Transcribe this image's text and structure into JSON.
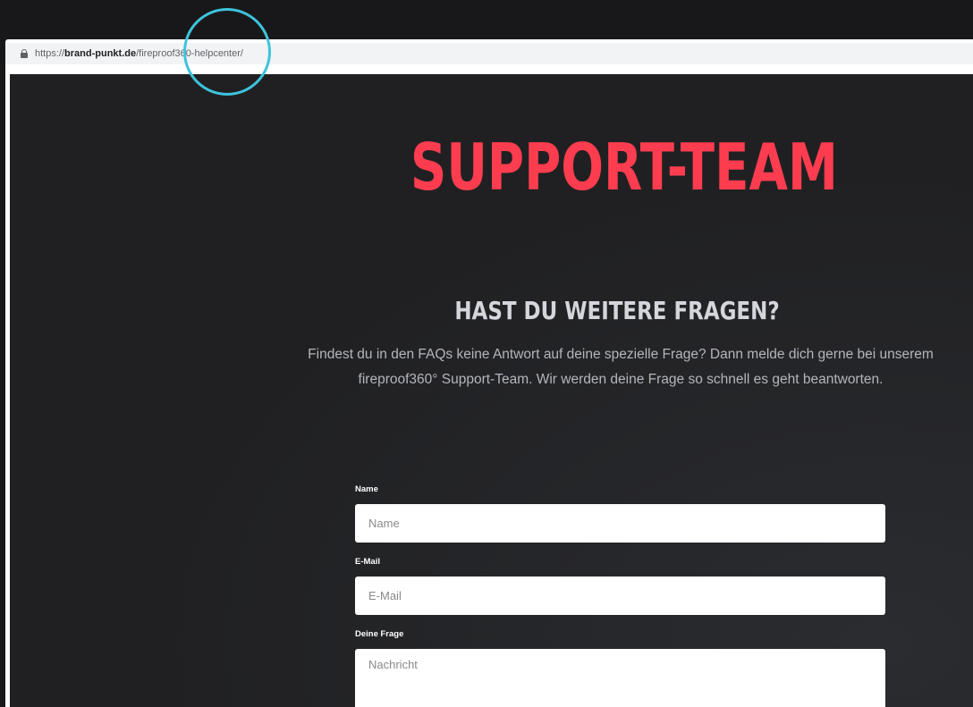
{
  "browser": {
    "url_scheme": "https://",
    "url_host": "brand-punkt.de",
    "url_path": "/fireproof360-helpcenter/"
  },
  "hero": {
    "title": "SUPPORT-TEAM",
    "title_color": "#fd3d4f"
  },
  "section": {
    "heading": "HAST DU WEITERE FRAGEN?",
    "text": "Findest du in den FAQs keine Antwort auf deine spezielle Frage? Dann melde dich gerne bei unserem fireproof360° Support-Team. Wir werden deine Frage so schnell es geht beantworten."
  },
  "form": {
    "name_label": "Name",
    "name_placeholder": "Name",
    "email_label": "E-Mail",
    "email_placeholder": "E-Mail",
    "question_label": "Deine Frage",
    "question_placeholder": "Nachricht"
  },
  "colors": {
    "page_background": "#202022",
    "accent": "#fd3d4f",
    "cursor_ring": "#3ec3dc"
  }
}
